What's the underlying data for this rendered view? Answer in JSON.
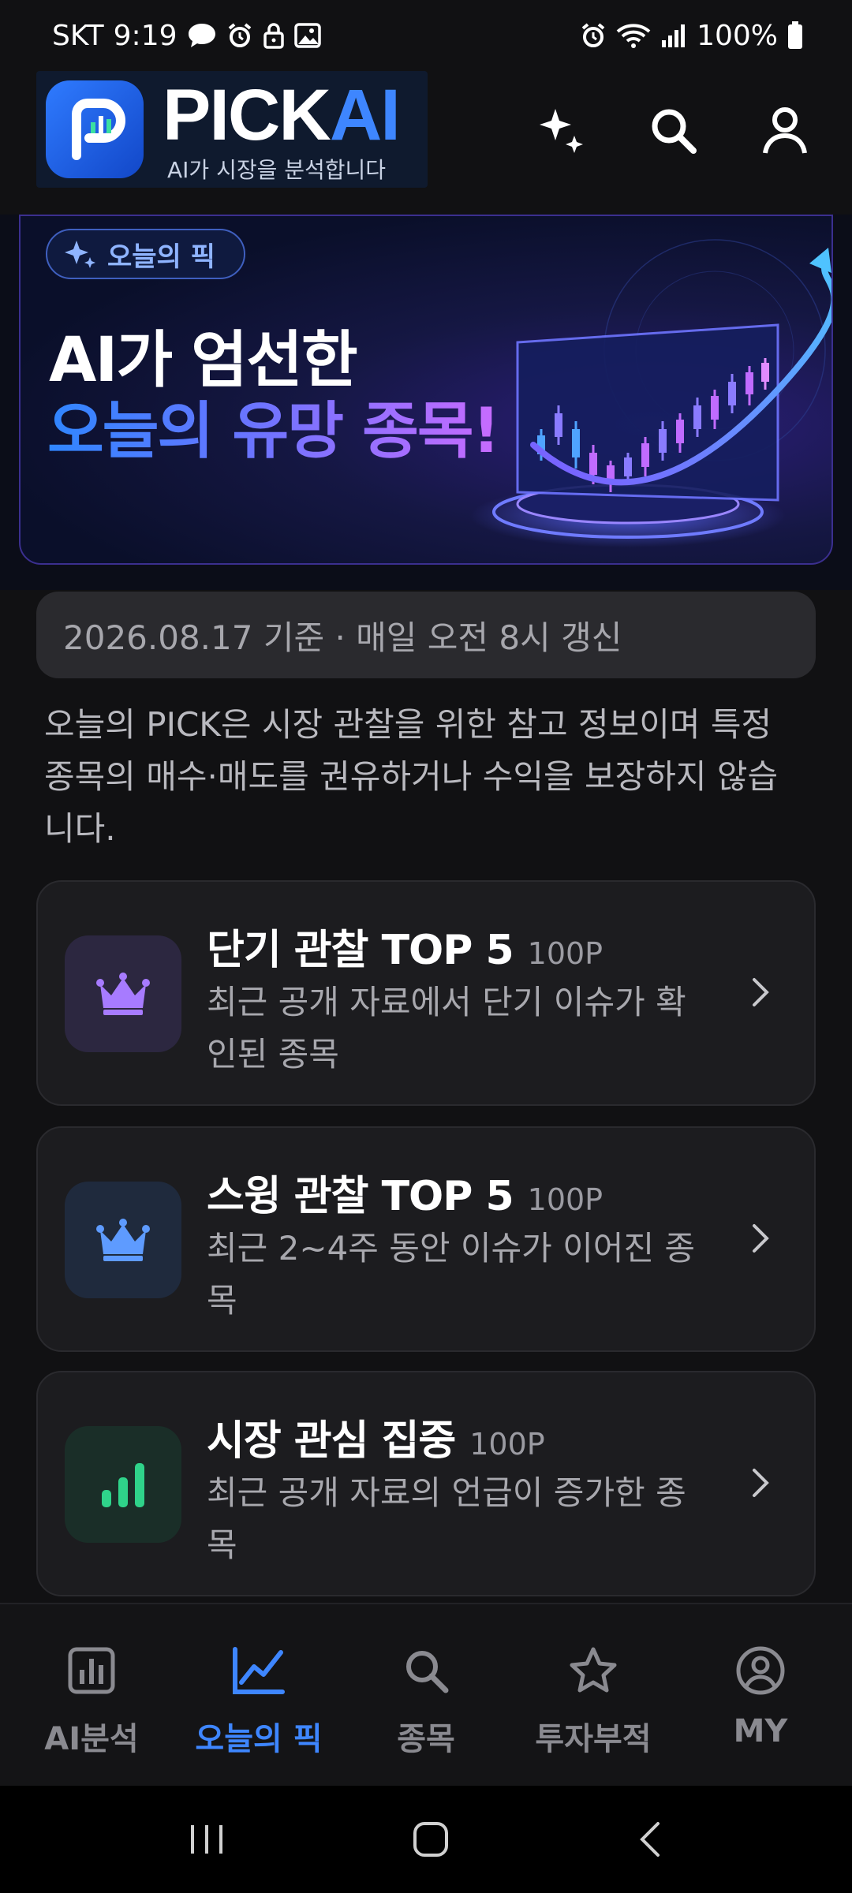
{
  "status_bar": {
    "carrier": "SKT",
    "time": "9:19",
    "battery": "100%"
  },
  "header": {
    "logo_pick": "PICK",
    "logo_ai": "AI",
    "tagline": "AI가 시장을 분석합니다",
    "actions": [
      "sparkle-icon",
      "search-icon",
      "user-icon"
    ]
  },
  "banner": {
    "pill": "오늘의 픽",
    "title_line1": "AI가 엄선한",
    "title_line2": "오늘의 유망 종목!"
  },
  "refresh_info": "2026.08.17 기준 · 매일 오전 8시 갱신",
  "disclaimer": "오늘의 PICK은 시장 관찰을 위한 참고 정보이며 특정 종목의 매수·매도를 권유하거나 수익을 보장하지 않습니다.",
  "cards": [
    {
      "title": "단기 관찰 TOP 5",
      "points": "100P",
      "desc": "최근 공개 자료에서 단기 이슈가 확인된 종목",
      "icon": "crown-icon",
      "color": "#a77bff"
    },
    {
      "title": "스윙 관찰 TOP 5",
      "points": "100P",
      "desc": "최근 2~4주 동안 이슈가 이어진 종목",
      "icon": "crown-icon",
      "color": "#5e9bff"
    },
    {
      "title": "시장 관심 집중",
      "points": "100P",
      "desc": "최근 공개 자료의 언급이 증가한 종목",
      "icon": "bar-chart-icon",
      "color": "#2fd38a"
    }
  ],
  "bottom_nav": [
    {
      "label": "AI분석",
      "active": false
    },
    {
      "label": "오늘의 픽",
      "active": true
    },
    {
      "label": "종목",
      "active": false
    },
    {
      "label": "투자부적",
      "active": false
    },
    {
      "label": "MY",
      "active": false
    }
  ],
  "accent_color": "#3e86ff"
}
